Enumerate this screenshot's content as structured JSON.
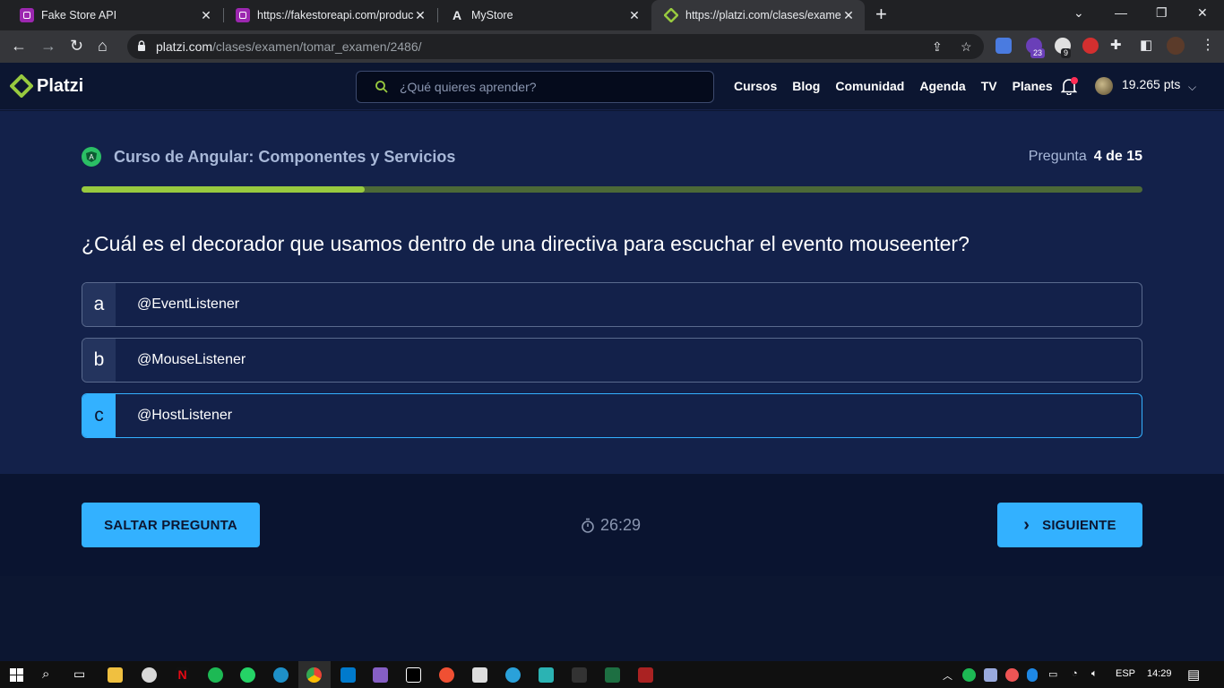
{
  "browser": {
    "tabs": [
      {
        "title": "Fake Store API",
        "favicon_color": "#9c27b0"
      },
      {
        "title": "https://fakestoreapi.com/product",
        "favicon_color": "#9c27b0"
      },
      {
        "title": "MyStore",
        "favicon_color": "#202124"
      },
      {
        "title": "https://platzi.com/clases/examen",
        "favicon_color": "#98ca3f",
        "active": true
      }
    ],
    "url_host": "platzi.com",
    "url_path": "/clases/examen/tomar_examen/2486/",
    "ext_badges": [
      "23",
      "9"
    ]
  },
  "site": {
    "logo_text": "Platzi",
    "search_placeholder": "¿Qué quieres aprender?",
    "nav": [
      "Cursos",
      "Blog",
      "Comunidad",
      "Agenda",
      "TV",
      "Planes"
    ],
    "points": "19.265 pts"
  },
  "exam": {
    "course_title": "Curso de Angular: Componentes y Servicios",
    "counter_label": "Pregunta",
    "counter_value": "4 de 15",
    "progress_fraction": 0.267,
    "question": "¿Cuál es el decorador que usamos dentro de una directiva para escuchar el evento mouseenter?",
    "options": [
      {
        "letter": "a",
        "text": "@EventListener",
        "selected": false
      },
      {
        "letter": "b",
        "text": "@MouseListener",
        "selected": false
      },
      {
        "letter": "c",
        "text": "@HostListener",
        "selected": true
      }
    ]
  },
  "actions": {
    "skip_label": "SALTAR PREGUNTA",
    "next_label": "SIGUIENTE",
    "timer": "26:29"
  },
  "taskbar": {
    "language": "ESP",
    "time": "14:29"
  },
  "colors": {
    "accent": "#33b1ff",
    "progress_fill": "#98ca3f",
    "progress_track": "#4c6937",
    "background": "#13214a"
  }
}
